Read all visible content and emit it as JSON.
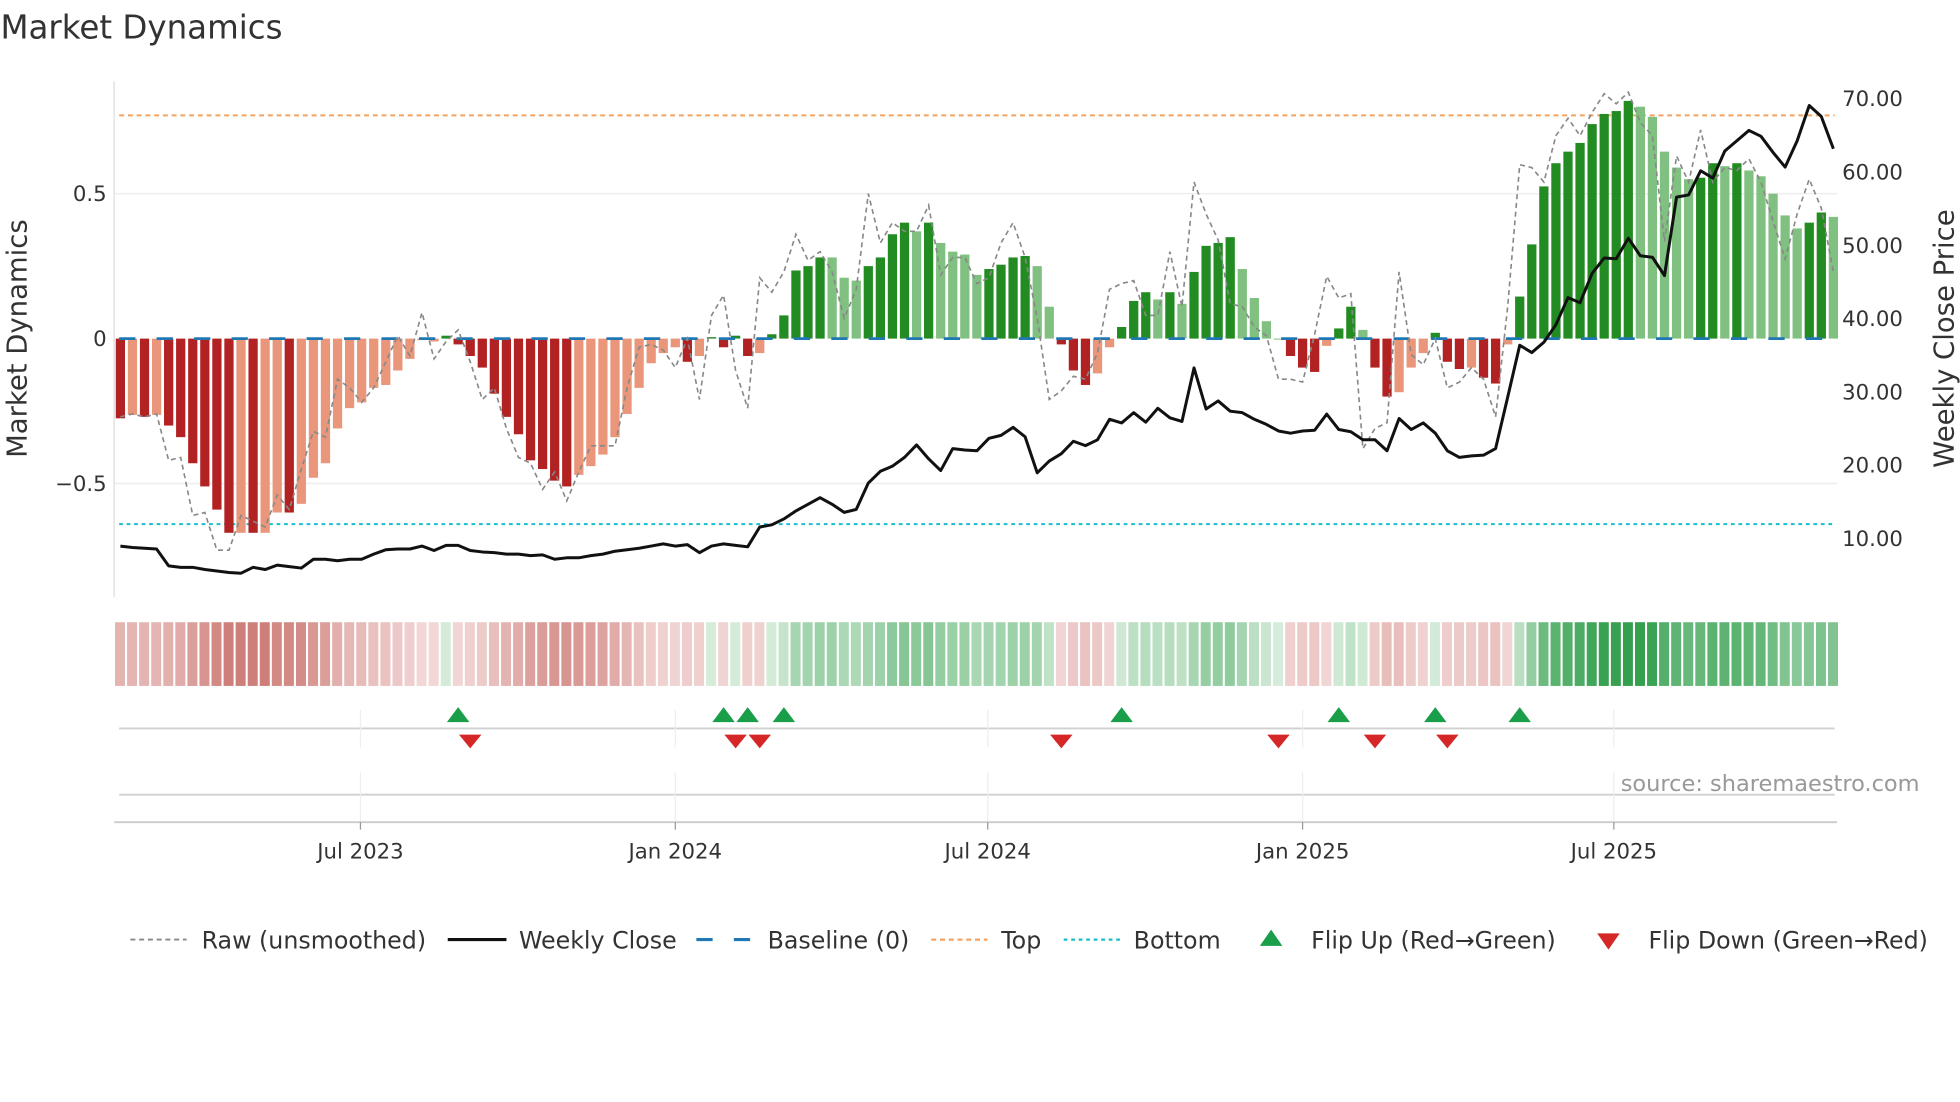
{
  "title": "Market Dynamics",
  "source": "source: sharemaestro.com",
  "colors": {
    "strong_red": "#b22222",
    "weak_red": "#e9967a",
    "strong_green": "#228b22",
    "weak_green": "#80c080",
    "raw": "#888888",
    "close": "#111111",
    "baseline": "#1f77b4",
    "top": "#f4a460",
    "bottom": "#17becf",
    "flip_up": "#1a9e4a",
    "flip_down": "#d62728"
  },
  "chart_data": {
    "type": "bar",
    "title": "Market Dynamics",
    "ylabel": "Market Dynamics",
    "y2label": "Weekly Close Price",
    "ylim": [
      -0.9,
      0.88
    ],
    "y2lim": [
      0,
      72
    ],
    "yticks": [
      {
        "value": 0.5,
        "label": "0.5"
      },
      {
        "value": 0,
        "label": "0"
      },
      {
        "value": -0.5,
        "label": "−0.5"
      }
    ],
    "y2ticks": [
      {
        "value": 70,
        "label": "70.00"
      },
      {
        "value": 60,
        "label": "60.00"
      },
      {
        "value": 50,
        "label": "50.00"
      },
      {
        "value": 40,
        "label": "40.00"
      },
      {
        "value": 30,
        "label": "30.00"
      },
      {
        "value": 20,
        "label": "20.00"
      },
      {
        "value": 10,
        "label": "10.00"
      }
    ],
    "x_ticks": [
      {
        "label": "Jul 2023",
        "week": 19.9
      },
      {
        "label": "Jan 2024",
        "week": 46.0
      },
      {
        "label": "Jul 2024",
        "week": 71.9
      },
      {
        "label": "Jan 2025",
        "week": 98.0
      },
      {
        "label": "Jul 2025",
        "week": 123.8
      }
    ],
    "top_level": 0.77,
    "bottom_level": -0.64,
    "baseline": 0,
    "values": [
      -0.275,
      -0.263,
      -0.27,
      -0.263,
      -0.3,
      -0.34,
      -0.43,
      -0.51,
      -0.59,
      -0.67,
      -0.67,
      -0.67,
      -0.67,
      -0.6,
      -0.6,
      -0.57,
      -0.48,
      -0.43,
      -0.31,
      -0.24,
      -0.22,
      -0.17,
      -0.16,
      -0.11,
      -0.07,
      -0.005,
      -0.01,
      0.01,
      -0.02,
      -0.06,
      -0.1,
      -0.19,
      -0.27,
      -0.33,
      -0.42,
      -0.45,
      -0.49,
      -0.51,
      -0.47,
      -0.44,
      -0.4,
      -0.34,
      -0.26,
      -0.17,
      -0.085,
      -0.05,
      -0.03,
      -0.08,
      -0.06,
      0.005,
      -0.03,
      0.01,
      -0.06,
      -0.05,
      0.015,
      0.08,
      0.235,
      0.25,
      0.28,
      0.28,
      0.21,
      0.2,
      0.25,
      0.28,
      0.36,
      0.4,
      0.37,
      0.4,
      0.33,
      0.3,
      0.29,
      0.22,
      0.24,
      0.255,
      0.28,
      0.285,
      0.25,
      0.11,
      -0.02,
      -0.11,
      -0.16,
      -0.12,
      -0.03,
      0.04,
      0.13,
      0.16,
      0.135,
      0.16,
      0.12,
      0.23,
      0.32,
      0.33,
      0.35,
      0.24,
      0.14,
      0.06,
      0.0,
      -0.06,
      -0.1,
      -0.115,
      -0.025,
      0.035,
      0.11,
      0.03,
      -0.1,
      -0.2,
      -0.185,
      -0.1,
      -0.05,
      0.02,
      -0.08,
      -0.105,
      -0.1,
      -0.135,
      -0.155,
      -0.02,
      0.145,
      0.325,
      0.525,
      0.605,
      0.645,
      0.675,
      0.74,
      0.775,
      0.785,
      0.82,
      0.8,
      0.765,
      0.645,
      0.59,
      0.55,
      0.555,
      0.605,
      0.595,
      0.605,
      0.58,
      0.56,
      0.5,
      0.425,
      0.38,
      0.4,
      0.435,
      0.42
    ],
    "strengthening": [
      1,
      0,
      1,
      0,
      1,
      1,
      1,
      1,
      1,
      1,
      0,
      1,
      0,
      0,
      1,
      0,
      0,
      0,
      0,
      0,
      0,
      0,
      0,
      0,
      0,
      0,
      0,
      1,
      1,
      1,
      1,
      1,
      1,
      1,
      1,
      1,
      1,
      1,
      0,
      0,
      0,
      0,
      0,
      0,
      0,
      0,
      0,
      1,
      0,
      1,
      1,
      1,
      1,
      0,
      1,
      1,
      1,
      1,
      1,
      0,
      0,
      0,
      1,
      1,
      1,
      1,
      0,
      1,
      0,
      0,
      0,
      0,
      1,
      1,
      1,
      1,
      0,
      0,
      1,
      1,
      1,
      0,
      0,
      1,
      1,
      1,
      0,
      1,
      0,
      1,
      1,
      1,
      1,
      0,
      0,
      0,
      0,
      1,
      1,
      1,
      0,
      1,
      1,
      0,
      1,
      1,
      0,
      0,
      0,
      1,
      1,
      1,
      0,
      1,
      1,
      0,
      1,
      1,
      1,
      1,
      1,
      1,
      1,
      1,
      1,
      1,
      0,
      0,
      0,
      0,
      0,
      1,
      1,
      0,
      1,
      0,
      0,
      0,
      0,
      0,
      1,
      1,
      0
    ],
    "raw": [
      -0.27,
      -0.26,
      -0.27,
      -0.26,
      -0.42,
      -0.41,
      -0.61,
      -0.6,
      -0.73,
      -0.73,
      -0.61,
      -0.63,
      -0.65,
      -0.54,
      -0.59,
      -0.45,
      -0.32,
      -0.34,
      -0.14,
      -0.17,
      -0.22,
      -0.17,
      -0.08,
      0.01,
      -0.06,
      0.09,
      -0.07,
      -0.01,
      0.03,
      -0.08,
      -0.21,
      -0.17,
      -0.31,
      -0.41,
      -0.43,
      -0.52,
      -0.46,
      -0.56,
      -0.46,
      -0.37,
      -0.37,
      -0.37,
      -0.17,
      -0.03,
      -0.02,
      -0.04,
      -0.1,
      0.0,
      -0.21,
      0.08,
      0.15,
      -0.11,
      -0.24,
      0.21,
      0.16,
      0.23,
      0.36,
      0.27,
      0.3,
      0.23,
      0.07,
      0.17,
      0.5,
      0.33,
      0.4,
      0.37,
      0.37,
      0.46,
      0.22,
      0.28,
      0.28,
      0.19,
      0.21,
      0.33,
      0.4,
      0.28,
      0.07,
      -0.21,
      -0.18,
      -0.13,
      -0.14,
      -0.05,
      0.17,
      0.19,
      0.2,
      0.08,
      0.08,
      0.3,
      0.11,
      0.54,
      0.43,
      0.34,
      0.12,
      0.11,
      0.04,
      0.01,
      -0.14,
      -0.14,
      -0.15,
      0.015,
      0.215,
      0.14,
      0.155,
      -0.38,
      -0.31,
      -0.29,
      0.23,
      -0.055,
      -0.09,
      0.0,
      -0.17,
      -0.15,
      -0.1,
      -0.14,
      -0.27,
      0.11,
      0.6,
      0.59,
      0.54,
      0.7,
      0.76,
      0.7,
      0.78,
      0.845,
      0.81,
      0.85,
      0.745,
      0.7,
      0.335,
      0.63,
      0.54,
      0.72,
      0.54,
      0.59,
      0.58,
      0.62,
      0.54,
      0.405,
      0.275,
      0.43,
      0.55,
      0.45,
      0.23
    ],
    "weekly_close": [
      8.8,
      8.6,
      8.5,
      8.4,
      6.1,
      5.9,
      5.9,
      5.6,
      5.4,
      5.2,
      5.1,
      5.9,
      5.6,
      6.2,
      6.0,
      5.8,
      7.0,
      7.0,
      6.8,
      7.0,
      7.0,
      7.7,
      8.3,
      8.4,
      8.4,
      8.8,
      8.2,
      8.9,
      8.9,
      8.2,
      8.0,
      7.9,
      7.7,
      7.7,
      7.5,
      7.6,
      7.0,
      7.2,
      7.2,
      7.5,
      7.7,
      8.1,
      8.3,
      8.5,
      8.8,
      9.1,
      8.8,
      9.0,
      7.9,
      8.8,
      9.1,
      8.9,
      8.7,
      11.4,
      11.7,
      12.5,
      13.6,
      14.5,
      15.4,
      14.5,
      13.4,
      13.8,
      17.4,
      19.0,
      19.7,
      20.9,
      22.6,
      20.7,
      19.1,
      22.1,
      21.9,
      21.8,
      23.5,
      23.9,
      25.0,
      23.7,
      18.8,
      20.4,
      21.4,
      23.1,
      22.5,
      23.3,
      26.1,
      25.6,
      27.0,
      25.7,
      27.6,
      26.3,
      25.8,
      33.1,
      27.5,
      28.6,
      27.2,
      27.0,
      26.1,
      25.4,
      24.5,
      24.2,
      24.5,
      24.6,
      26.8,
      24.7,
      24.4,
      23.3,
      23.3,
      21.8,
      26.2,
      24.7,
      25.6,
      24.2,
      21.8,
      20.9,
      21.1,
      21.2,
      22.1,
      29.1,
      36.2,
      35.2,
      36.6,
      39.0,
      42.7,
      42.0,
      46.0,
      48.1,
      48.0,
      50.8,
      48.4,
      48.2,
      45.7,
      56.4,
      56.7,
      60.0,
      59.0,
      62.7,
      64.1,
      65.5,
      64.7,
      62.5,
      60.5,
      64.1,
      68.9,
      67.4,
      63.0
    ],
    "flip_up_weeks": [
      28,
      50,
      52,
      55,
      83,
      101,
      109,
      116
    ],
    "flip_down_weeks": [
      29,
      51,
      53,
      78,
      96,
      104,
      110
    ],
    "legend": {
      "raw": "Raw (unsmoothed)",
      "close": "Weekly Close",
      "baseline": "Baseline (0)",
      "top": "Top",
      "bottom": "Bottom",
      "flip_up": "Flip Up (Red→Green)",
      "flip_down": "Flip Down (Green→Red)"
    },
    "legend_position": "bottom"
  }
}
